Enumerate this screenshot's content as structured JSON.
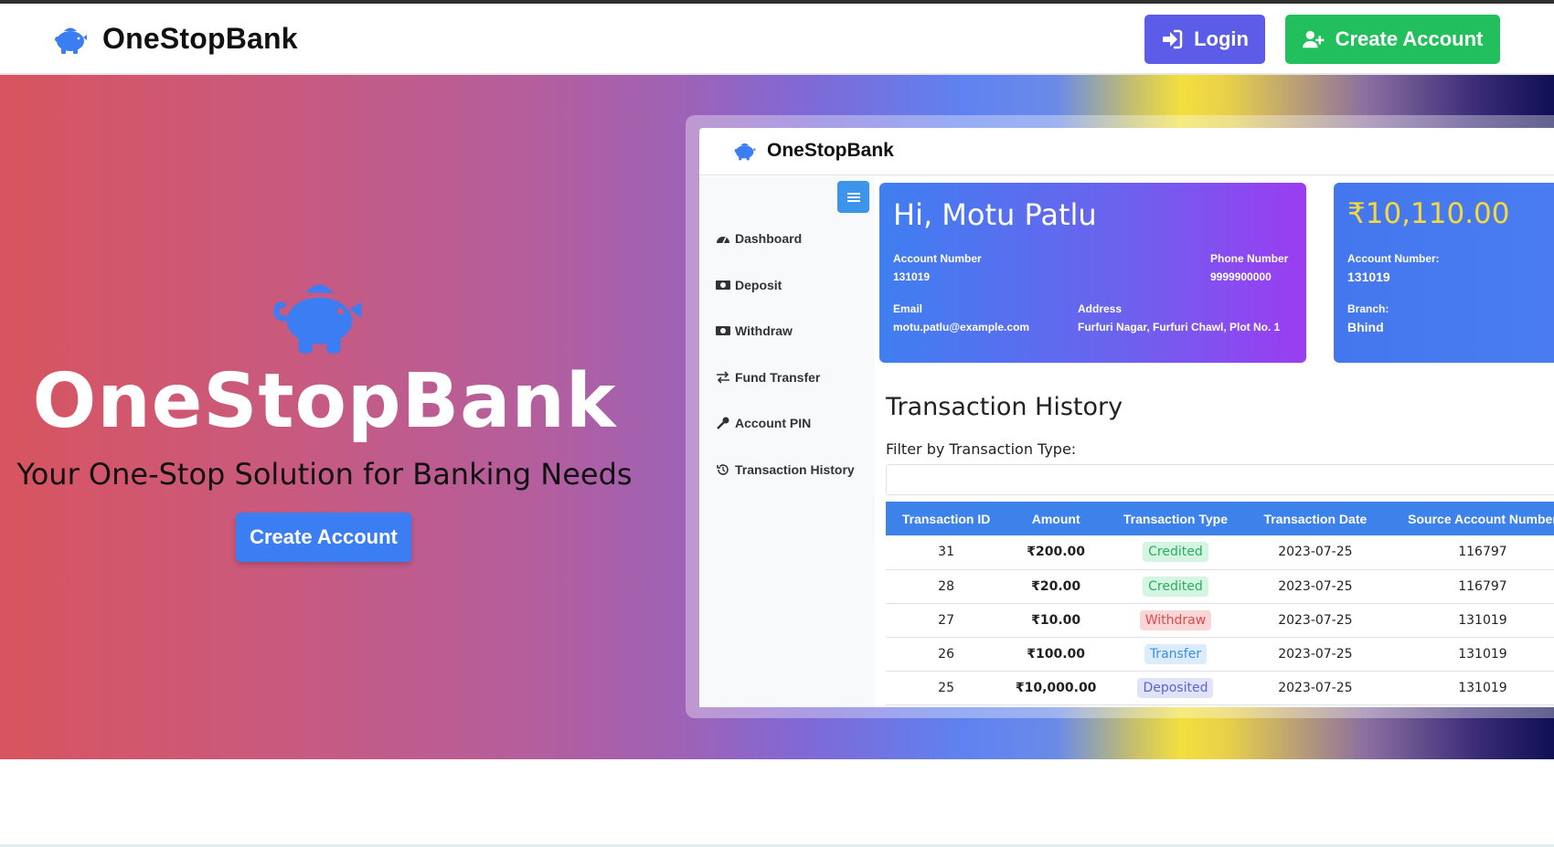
{
  "nav": {
    "brand": "OneStopBank",
    "login_label": "Login",
    "create_label": "Create Account"
  },
  "hero": {
    "title": "OneStopBank",
    "subtitle": "Your One-Stop Solution for Banking Needs",
    "cta_label": "Create Account"
  },
  "mock": {
    "brand": "OneStopBank",
    "sidebar": [
      {
        "label": "Dashboard",
        "icon": "dashboard-icon"
      },
      {
        "label": "Deposit",
        "icon": "money-icon"
      },
      {
        "label": "Withdraw",
        "icon": "money-icon"
      },
      {
        "label": "Fund Transfer",
        "icon": "transfer-icon"
      },
      {
        "label": "Account PIN",
        "icon": "key-icon"
      },
      {
        "label": "Transaction History",
        "icon": "history-icon"
      }
    ],
    "profile": {
      "greeting": "Hi, Motu Patlu",
      "account_number_label": "Account Number",
      "account_number": "131019",
      "phone_label": "Phone Number",
      "phone": "9999900000",
      "email_label": "Email",
      "email": "motu.patlu@example.com",
      "address_label": "Address",
      "address": "Furfuri Nagar, Furfuri Chawl, Plot No. 1"
    },
    "balance": {
      "amount": "₹10,110.00",
      "account_label": "Account Number:",
      "account_number": "131019",
      "branch_label": "Branch:",
      "branch": "Bhind"
    },
    "history_title": "Transaction History",
    "filter_label": "Filter by Transaction Type:",
    "columns": [
      "Transaction ID",
      "Amount",
      "Transaction Type",
      "Transaction Date",
      "Source Account Number"
    ],
    "rows": [
      {
        "id": "31",
        "amount": "₹200.00",
        "type": "Credited",
        "date": "2023-07-25",
        "source": "116797"
      },
      {
        "id": "28",
        "amount": "₹20.00",
        "type": "Credited",
        "date": "2023-07-25",
        "source": "116797"
      },
      {
        "id": "27",
        "amount": "₹10.00",
        "type": "Withdraw",
        "date": "2023-07-25",
        "source": "131019"
      },
      {
        "id": "26",
        "amount": "₹100.00",
        "type": "Transfer",
        "date": "2023-07-25",
        "source": "131019"
      },
      {
        "id": "25",
        "amount": "₹10,000.00",
        "type": "Deposited",
        "date": "2023-07-25",
        "source": "131019"
      }
    ]
  },
  "colors": {
    "login": "#5b5de8",
    "create": "#22c05c",
    "primary": "#3b7df2"
  }
}
